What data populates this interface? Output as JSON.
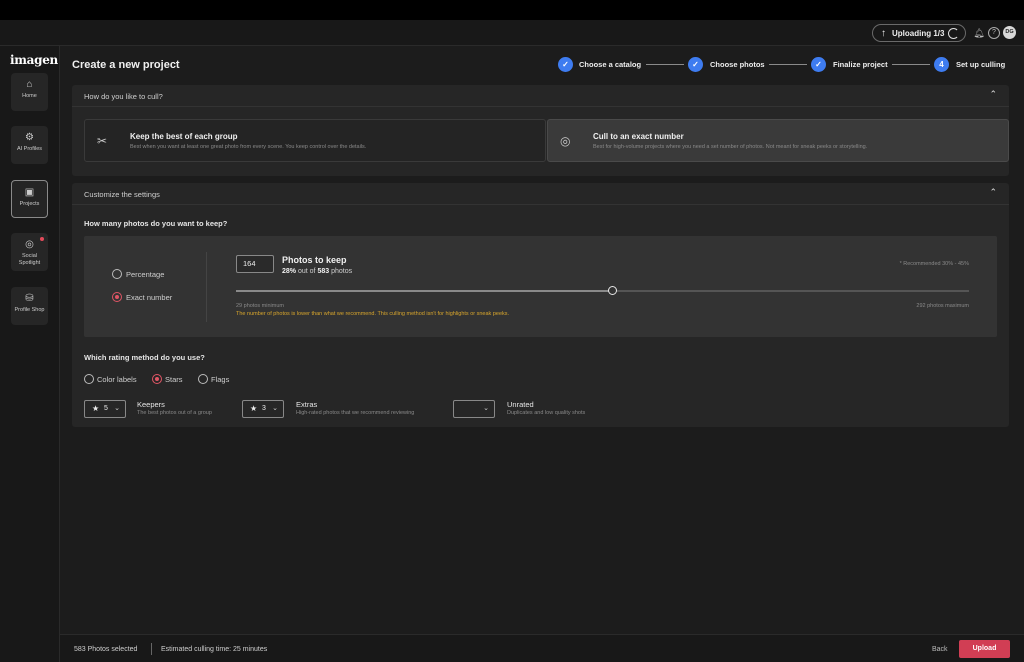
{
  "topbar": {
    "upload_status": "Uploading 1/3",
    "avatar_initials": "DG"
  },
  "sidebar": {
    "logo": "imagen",
    "items": [
      {
        "label": "Home",
        "icon": "home-icon"
      },
      {
        "label": "AI Profiles",
        "icon": "ai-profiles-icon"
      },
      {
        "label": "Projects",
        "icon": "projects-icon",
        "active": true
      },
      {
        "label": "Social Spotlight",
        "icon": "social-spotlight-icon",
        "notification": true
      },
      {
        "label": "Profile Shop",
        "icon": "profile-shop-icon"
      }
    ]
  },
  "header": {
    "title": "Create a new project"
  },
  "stepper": {
    "steps": [
      {
        "label": "Choose a catalog",
        "state": "done"
      },
      {
        "label": "Choose photos",
        "state": "done"
      },
      {
        "label": "Finalize project",
        "state": "done"
      },
      {
        "label": "Set up culling",
        "number": "4",
        "state": "current"
      }
    ]
  },
  "cull_section": {
    "title": "How do you like to cull?",
    "options": [
      {
        "title": "Keep the best of each group",
        "desc": "Best when you want at least one great photo from every scene. You keep control over the details.",
        "selected": false
      },
      {
        "title": "Cull to an exact number",
        "desc": "Best for high-volume projects where you need a set number of photos. Not meant for sneak peeks or storytelling.",
        "selected": true
      }
    ]
  },
  "settings": {
    "title": "Customize the settings",
    "keep_question": "How many photos do you want to keep?",
    "mode_options": [
      {
        "label": "Percentage",
        "selected": false
      },
      {
        "label": "Exact number",
        "selected": true
      }
    ],
    "photos_to_keep": {
      "value": "164",
      "title": "Photos to keep",
      "percent": "28%",
      "out_of_text": "out of",
      "total": "583",
      "unit": "photos",
      "recommended": "* Recommended 30% - 45%",
      "slider_min": 29,
      "slider_max": 292,
      "slider_value": 164,
      "min_label": "29 photos minimum",
      "max_label": "292 photos maximum",
      "warning": "The number of photos is lower than what we recommend. This culling method isn't for highlights or sneak peeks."
    },
    "rating_question": "Which rating method do you use?",
    "rating_methods": [
      {
        "label": "Color labels",
        "selected": false
      },
      {
        "label": "Stars",
        "selected": true
      },
      {
        "label": "Flags",
        "selected": false
      }
    ],
    "categories": [
      {
        "value": "5",
        "title": "Keepers",
        "desc": "The best photos out of a group",
        "has_star": true
      },
      {
        "value": "3",
        "title": "Extras",
        "desc": "High-rated photos that we recommend reviewing",
        "has_star": true
      },
      {
        "value": "",
        "title": "Unrated",
        "desc": "Duplicates and low quality shots",
        "has_star": false
      }
    ]
  },
  "footer": {
    "selected": "583 Photos selected",
    "estimate": "Estimated culling time: 25 minutes",
    "back": "Back",
    "upload": "Upload"
  },
  "colors": {
    "accent_blue": "#3e7cf0",
    "accent_red": "#d13e54",
    "warning": "#d9a62c"
  }
}
